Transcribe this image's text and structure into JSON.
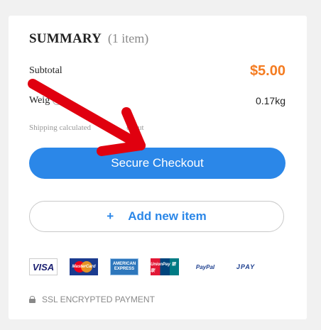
{
  "summary": {
    "title": "SUMMARY",
    "item_count": "(1 item)",
    "subtotal_label": "Subtotal",
    "subtotal_value": "$5.00",
    "weight_label": "Weig",
    "weight_value": "0.17kg",
    "shipping_note": "Shipping calculated",
    "shipping_note_tail": "ckout"
  },
  "actions": {
    "checkout_label": "Secure Checkout",
    "add_plus": "+",
    "add_label": "Add new item"
  },
  "payments": {
    "visa": "VISA",
    "mastercard": "MasterCard",
    "amex_line1": "AMERICAN",
    "amex_line2": "EXPRESS",
    "unionpay": "UnionPay 银联",
    "paypal": "PayPal",
    "jpay": "JPAY"
  },
  "security": {
    "ssl_label": "SSL ENCRYPTED PAYMENT"
  },
  "colors": {
    "accent": "#2b87e8",
    "price": "#f47c21",
    "arrow": "#e0000f"
  }
}
